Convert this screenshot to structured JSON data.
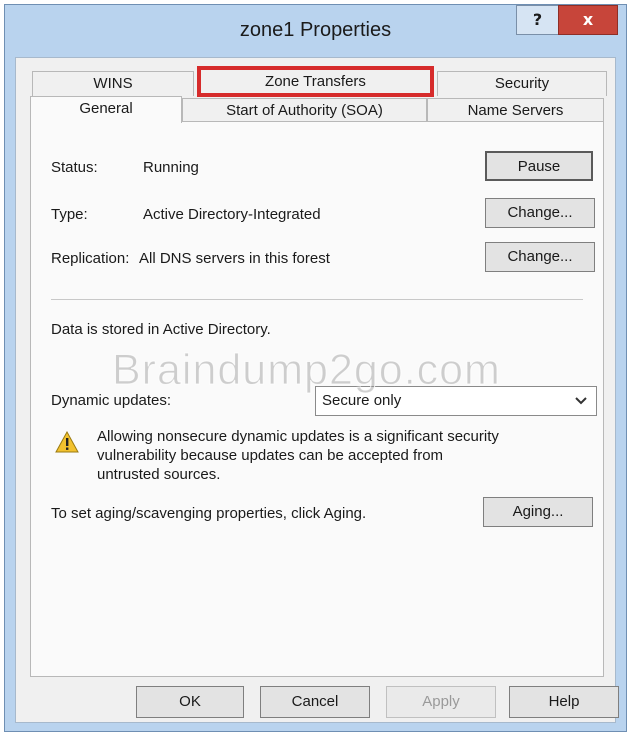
{
  "window": {
    "title": "zone1 Properties",
    "help_label": "?",
    "close_label": "x"
  },
  "tabs": {
    "row1": [
      "WINS",
      "Zone Transfers",
      "Security"
    ],
    "row2": [
      "General",
      "Start of Authority (SOA)",
      "Name Servers"
    ],
    "selected": "General",
    "highlighted": "Zone Transfers",
    "highlight_color": "#d62b2b"
  },
  "general": {
    "status_label": "Status:",
    "status_value": "Running",
    "pause_button": "Pause",
    "type_label": "Type:",
    "type_value": "Active Directory-Integrated",
    "type_change_button": "Change...",
    "replication_label": "Replication:",
    "replication_value": "All DNS servers in this forest",
    "replication_change_button": "Change...",
    "storage_text": "Data is stored in Active Directory.",
    "dynamic_updates_label": "Dynamic updates:",
    "dynamic_updates_value": "Secure only",
    "warning_text": "Allowing nonsecure dynamic updates is a significant security vulnerability because updates can be accepted from untrusted sources.",
    "aging_text": "To set aging/scavenging properties, click Aging.",
    "aging_button": "Aging..."
  },
  "footer": {
    "ok": "OK",
    "cancel": "Cancel",
    "apply": "Apply",
    "help": "Help"
  },
  "watermark": "Braindump2go.com",
  "colors": {
    "frame": "#b9d3ee",
    "close": "#c7453a",
    "warning": "#f2c12e"
  }
}
